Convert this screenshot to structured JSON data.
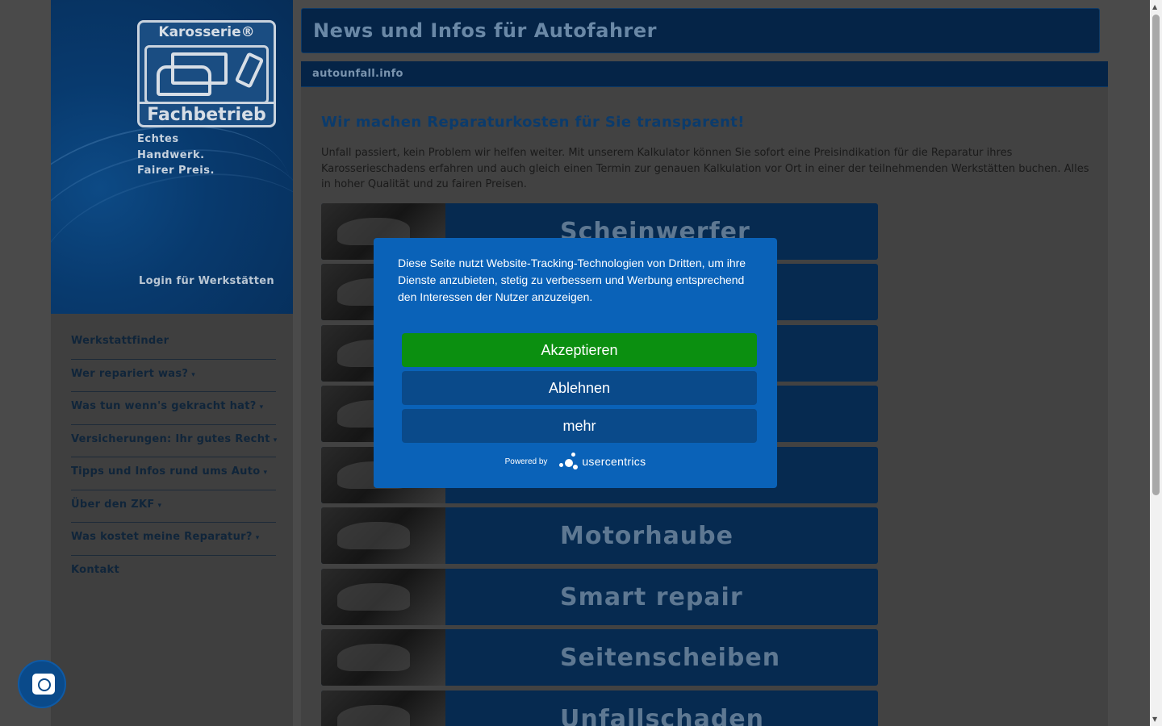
{
  "sidebar": {
    "logo_top": "Karosserie®",
    "logo_bottom": "Fachbetrieb",
    "tagline": [
      "Echtes",
      "Handwerk.",
      "Fairer Preis."
    ],
    "login_link": "Login für Werkstätten",
    "nav": [
      {
        "label": "Werkstattfinder",
        "dropdown": false
      },
      {
        "label": "Wer repariert was?",
        "dropdown": true
      },
      {
        "label": "Was tun wenn's gekracht hat?",
        "dropdown": true
      },
      {
        "label": "Versicherungen: Ihr gutes Recht",
        "dropdown": true
      },
      {
        "label": "Tipps und Infos rund ums Auto",
        "dropdown": true
      },
      {
        "label": "Über den ZKF",
        "dropdown": true
      },
      {
        "label": "Was kostet meine Reparatur?",
        "dropdown": true
      },
      {
        "label": "Kontakt",
        "dropdown": false
      }
    ],
    "dropdown_arrow": "▾"
  },
  "header": {
    "title": "News und Infos für Autofahrer",
    "breadcrumb": "autounfall.info"
  },
  "main": {
    "heading": "Wir machen Reparaturkosten für Sie transparent!",
    "intro": "Unfall passiert, kein Problem wir helfen weiter. Mit unserem Kalkulator können Sie sofort eine Preisindikation für die Reparatur ihres Karosserieschadens erfahren und auch gleich einen Termin zur genauen Kalkulation vor Ort in einer der teilnehmenden Werkstätten buchen. Alles in hoher Qualität und zu fairen Preisen.",
    "tiles": [
      "Scheinwerfer",
      "",
      "",
      "",
      "",
      "Motorhaube",
      "Smart repair",
      "Seitenscheiben",
      "Unfallschaden"
    ]
  },
  "cookie_banner": {
    "text": "Diese Seite nutzt Website-Tracking-Technologien von Dritten, um ihre Dienste anzubieten, stetig zu verbessern und Werbung entsprechend den Interessen der Nutzer anzuzeigen.",
    "accept": "Akzeptieren",
    "decline": "Ablehnen",
    "more": "mehr",
    "powered_by": "Powered by",
    "brand": "usercentrics",
    "colors": {
      "background": "#0a62b8",
      "accept": "#0b8f10",
      "secondary": "#0a4a8a"
    }
  },
  "privacy_button": {
    "icon": "fingerprint-icon"
  }
}
